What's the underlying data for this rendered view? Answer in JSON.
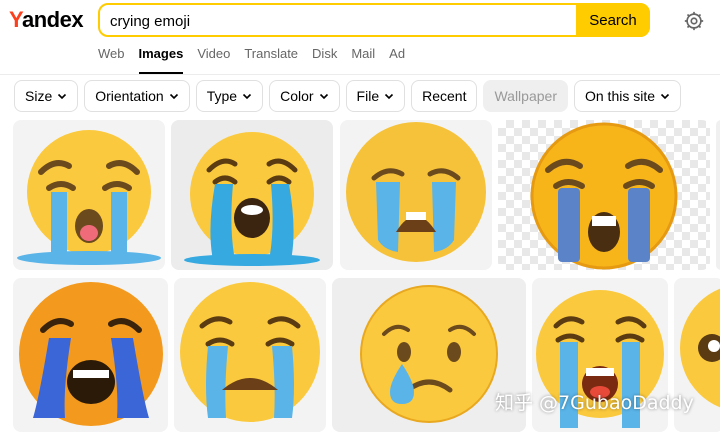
{
  "logo": "Yandex",
  "search": {
    "value": "crying emoji",
    "button": "Search"
  },
  "tabs": [
    "Web",
    "Images",
    "Video",
    "Translate",
    "Disk",
    "Mail",
    "Ad"
  ],
  "filters": {
    "size": "Size",
    "orientation": "Orientation",
    "type": "Type",
    "color": "Color",
    "file": "File",
    "recent": "Recent",
    "wallpaper": "Wallpaper",
    "on_this_site": "On this site"
  },
  "watermark": "知乎 @7GubaoDaddy",
  "colors": {
    "accent": "#ffcc00",
    "logo_red": "#fc3f1d",
    "emoji_yellow": "#fbc93d",
    "tears": "#5ab4e8"
  }
}
